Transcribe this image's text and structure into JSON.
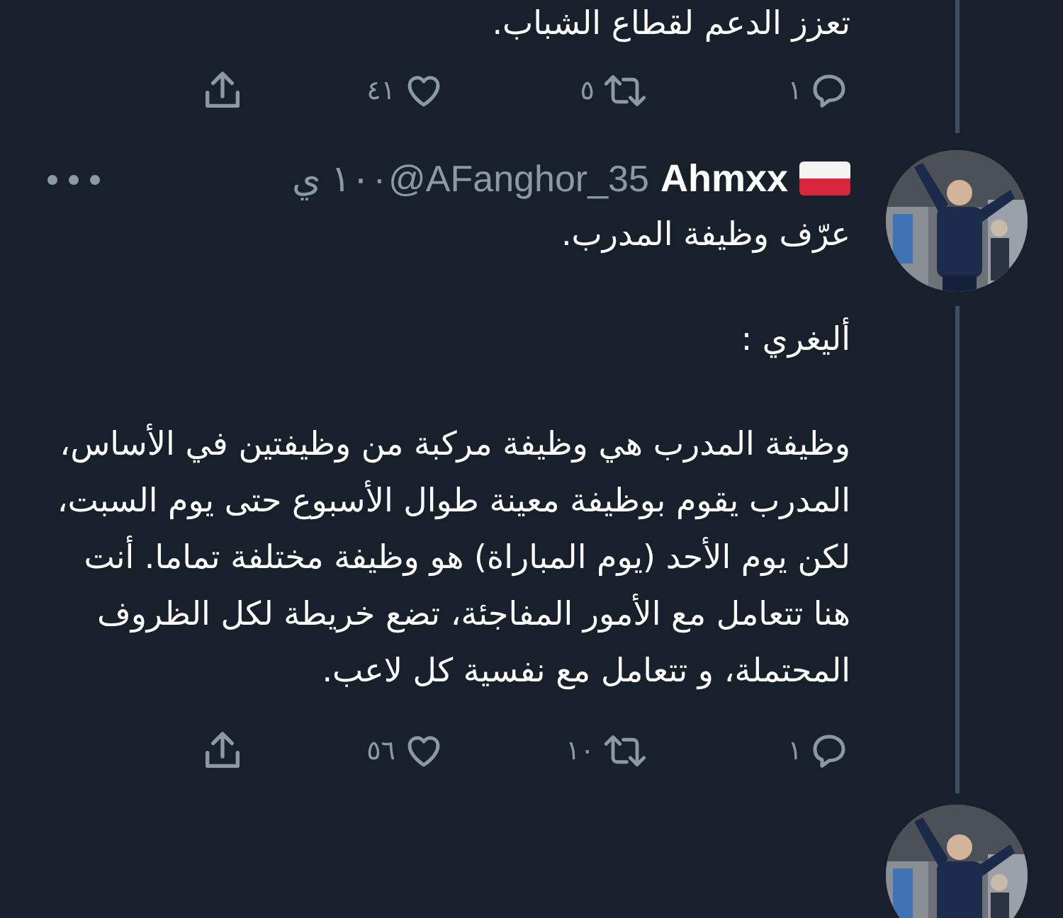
{
  "previous_tweet": {
    "text": "تعزز الدعم لقطاع الشباب.",
    "actions": [
      {
        "kind": "reply",
        "count": "١"
      },
      {
        "kind": "retweet",
        "count": "٥"
      },
      {
        "kind": "like",
        "count": "٤١"
      },
      {
        "kind": "share"
      }
    ]
  },
  "tweet": {
    "name": "Ahmxx",
    "handle": "@AFanghor_35",
    "separator": "·",
    "time": "١٠ ي",
    "paragraphs": [
      "عرّف وظيفة المدرب.",
      "أليغري :",
      "وظيفة المدرب هي وظيفة مركبة من وظيفتين في الأساس، المدرب يقوم بوظيفة معينة طوال الأسبوع حتى يوم السبت، لكن يوم الأحد (يوم المباراة) هو وظيفة مختلفة تماما. أنت هنا تتعامل مع الأمور المفاجئة، تضع خريطة لكل الظروف المحتملة، و تتعامل مع نفسية كل لاعب."
    ],
    "actions": [
      {
        "kind": "reply",
        "count": "١"
      },
      {
        "kind": "retweet",
        "count": "١٠"
      },
      {
        "kind": "like",
        "count": "٥٦"
      },
      {
        "kind": "share"
      }
    ]
  }
}
